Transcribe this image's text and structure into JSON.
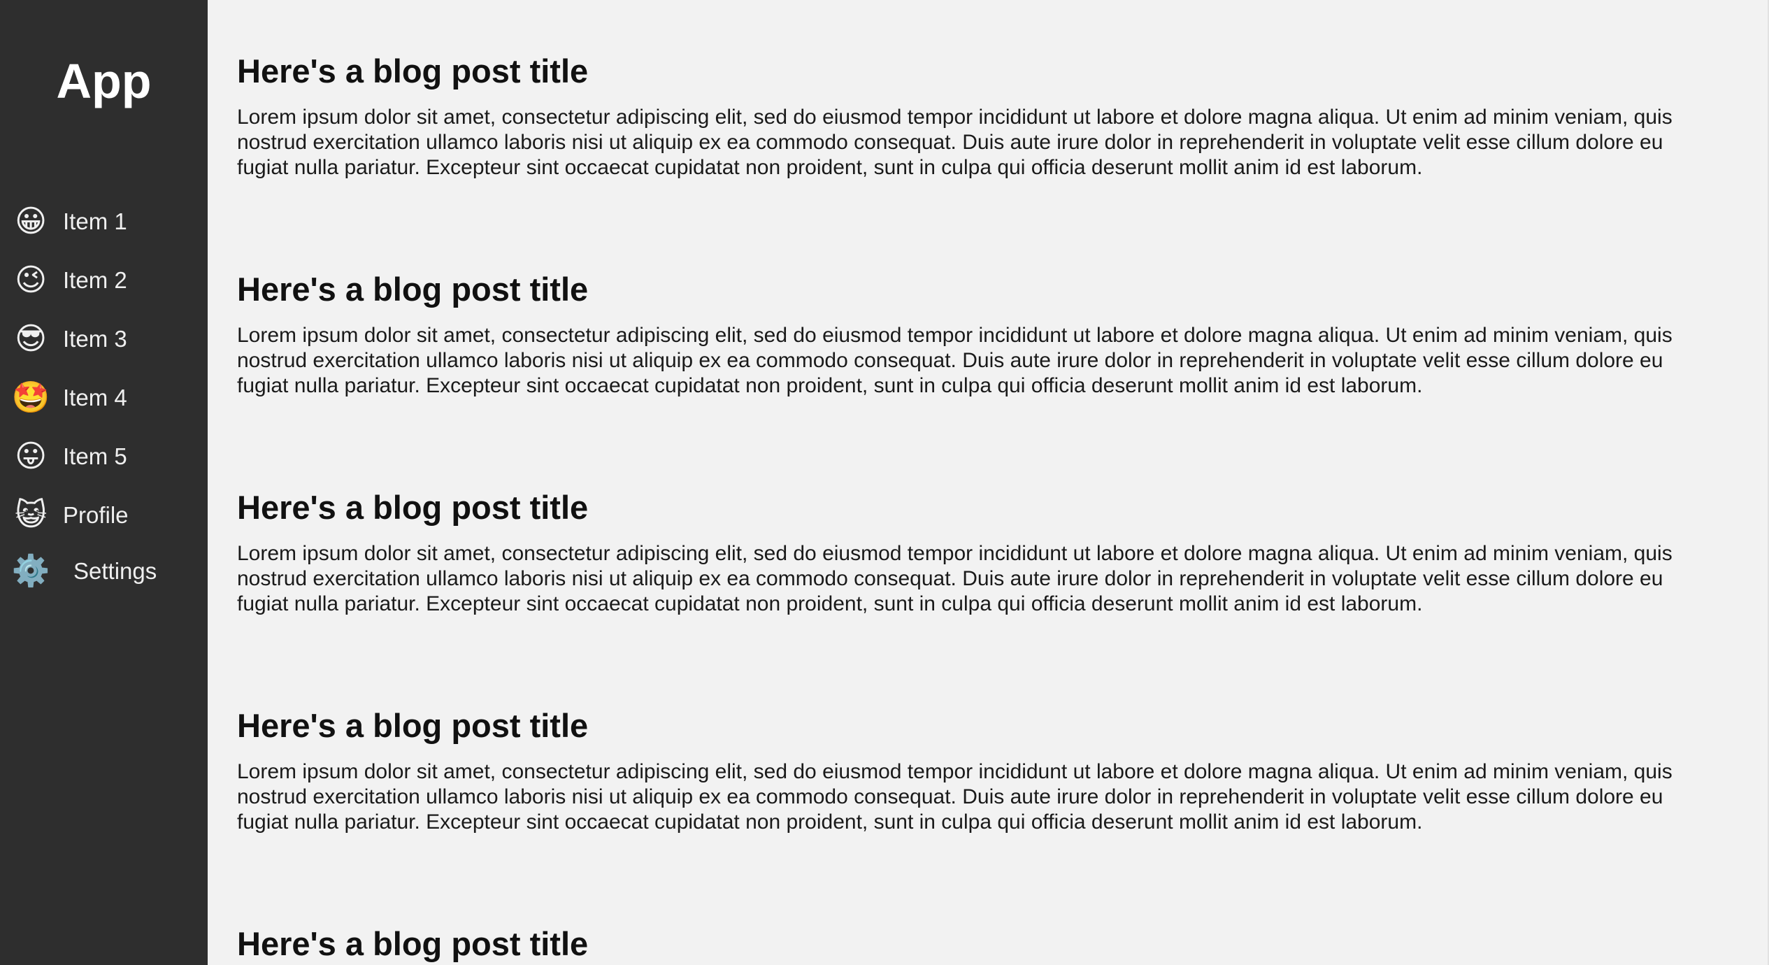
{
  "app": {
    "title": "App"
  },
  "sidebar": {
    "items": [
      {
        "label": "Item 1",
        "icon": "grinning-face-icon",
        "glyph": "😀"
      },
      {
        "label": "Item 2",
        "icon": "winking-face-icon",
        "glyph": "😉"
      },
      {
        "label": "Item 3",
        "icon": "sunglasses-face-icon",
        "glyph": "😎"
      },
      {
        "label": "Item 4",
        "icon": "star-struck-face-icon",
        "glyph": "🤩"
      },
      {
        "label": "Item 5",
        "icon": "tongue-out-face-icon",
        "glyph": "😛"
      },
      {
        "label": "Profile",
        "icon": "cat-face-icon",
        "glyph": "😺"
      },
      {
        "label": "Settings",
        "icon": "gear-icon",
        "glyph": "⚙️"
      }
    ]
  },
  "posts": [
    {
      "title": "Here's a blog post title",
      "body": "Lorem ipsum dolor sit amet, consectetur adipiscing elit, sed do eiusmod tempor incididunt ut labore et dolore magna aliqua. Ut enim ad minim veniam, quis nostrud exercitation ullamco laboris nisi ut aliquip ex ea commodo consequat. Duis aute irure dolor in reprehenderit in voluptate velit esse cillum dolore eu fugiat nulla pariatur. Excepteur sint occaecat cupidatat non proident, sunt in culpa qui officia deserunt mollit anim id est laborum."
    },
    {
      "title": "Here's a blog post title",
      "body": "Lorem ipsum dolor sit amet, consectetur adipiscing elit, sed do eiusmod tempor incididunt ut labore et dolore magna aliqua. Ut enim ad minim veniam, quis nostrud exercitation ullamco laboris nisi ut aliquip ex ea commodo consequat. Duis aute irure dolor in reprehenderit in voluptate velit esse cillum dolore eu fugiat nulla pariatur. Excepteur sint occaecat cupidatat non proident, sunt in culpa qui officia deserunt mollit anim id est laborum."
    },
    {
      "title": "Here's a blog post title",
      "body": "Lorem ipsum dolor sit amet, consectetur adipiscing elit, sed do eiusmod tempor incididunt ut labore et dolore magna aliqua. Ut enim ad minim veniam, quis nostrud exercitation ullamco laboris nisi ut aliquip ex ea commodo consequat. Duis aute irure dolor in reprehenderit in voluptate velit esse cillum dolore eu fugiat nulla pariatur. Excepteur sint occaecat cupidatat non proident, sunt in culpa qui officia deserunt mollit anim id est laborum."
    },
    {
      "title": "Here's a blog post title",
      "body": "Lorem ipsum dolor sit amet, consectetur adipiscing elit, sed do eiusmod tempor incididunt ut labore et dolore magna aliqua. Ut enim ad minim veniam, quis nostrud exercitation ullamco laboris nisi ut aliquip ex ea commodo consequat. Duis aute irure dolor in reprehenderit in voluptate velit esse cillum dolore eu fugiat nulla pariatur. Excepteur sint occaecat cupidatat non proident, sunt in culpa qui officia deserunt mollit anim id est laborum."
    },
    {
      "title": "Here's a blog post title"
    }
  ],
  "colors": {
    "sidebar_bg": "#2e2e2e",
    "content_bg": "#f2f2f2",
    "sidebar_text": "#efefef",
    "title_text": "#111111"
  }
}
